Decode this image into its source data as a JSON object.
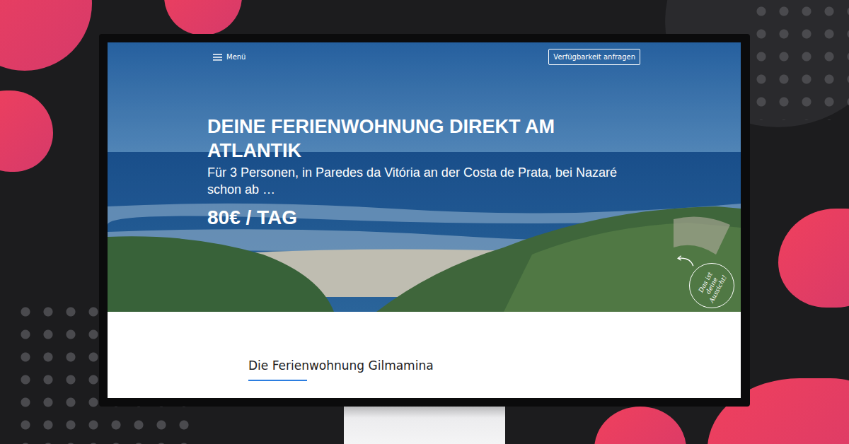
{
  "nav": {
    "menu_label": "Menü",
    "cta": "Verfügbarkeit anfragen"
  },
  "hero": {
    "headline": "DEINE FERIENWOHNUNG DIREKT AM ATLANTIK",
    "subtitle": "Für 3 Personen, in Paredes da Vitória an der Costa de Prata, bei Nazaré schon ab …",
    "price": "80€ / TAG",
    "badge": "Das ist deine Aussicht!"
  },
  "section": {
    "title": "Die Ferienwohnung Gilmamina"
  }
}
